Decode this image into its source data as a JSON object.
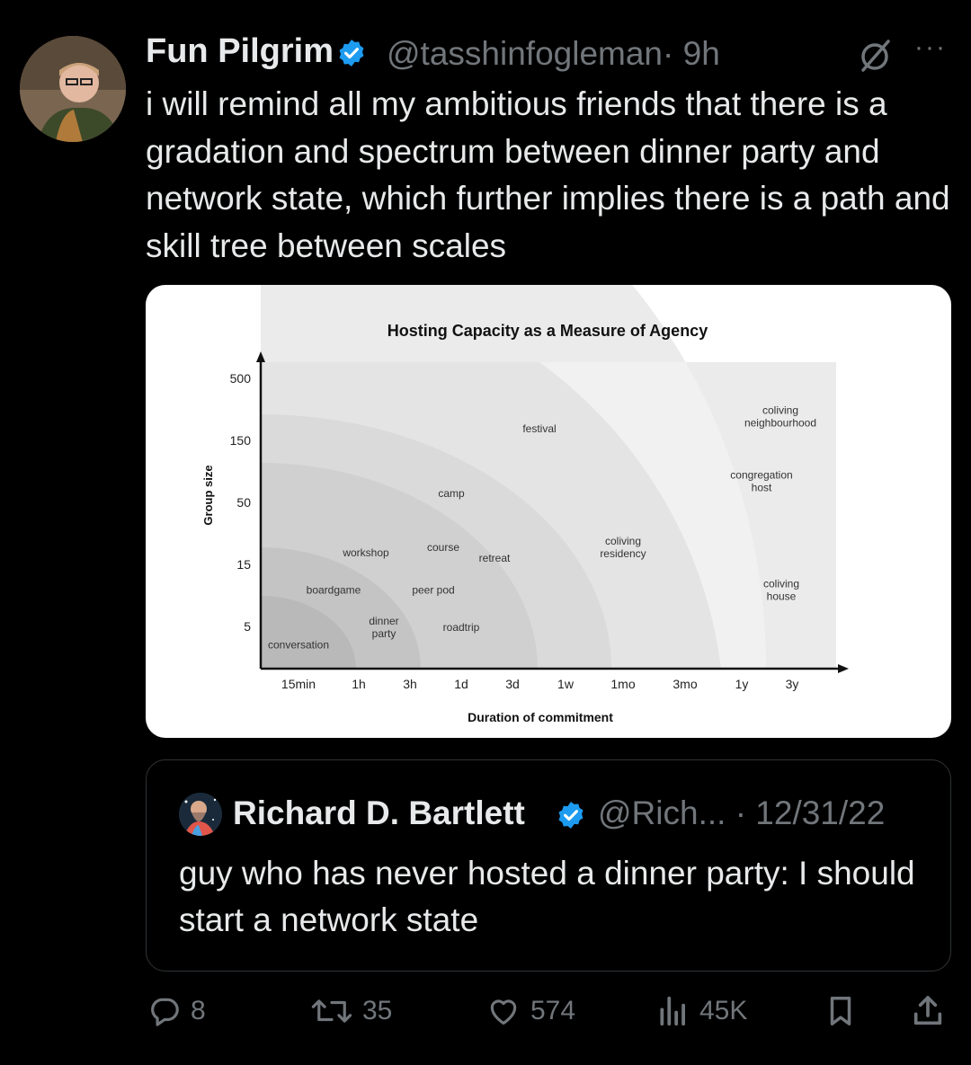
{
  "tweet": {
    "author_name": "Fun Pilgrim",
    "handle": "@tasshinfogleman",
    "time": "· 9h",
    "more": "···",
    "text": "i will remind all my ambitious friends that there is a gradation and spectrum between dinner party and network state, which further implies there is a path and skill tree between scales"
  },
  "chart_data": {
    "type": "scatter",
    "title": "Hosting Capacity as a Measure of Agency",
    "xlabel": "Duration of commitment",
    "ylabel": "Group size",
    "x_ticks": [
      "15min",
      "1h",
      "3h",
      "1d",
      "3d",
      "1w",
      "1mo",
      "3mo",
      "1y",
      "3y"
    ],
    "y_ticks": [
      "5",
      "15",
      "50",
      "150",
      "500"
    ],
    "points": [
      {
        "label": "conversation",
        "x": "15min",
        "y": 4
      },
      {
        "label": "dinner party",
        "x": "3h",
        "y": 5
      },
      {
        "label": "boardgame",
        "x": "1h",
        "y": 10
      },
      {
        "label": "peer pod",
        "x": "3h",
        "y": 10
      },
      {
        "label": "roadtrip",
        "x": "1d",
        "y": 5
      },
      {
        "label": "workshop",
        "x": "1h",
        "y": 20
      },
      {
        "label": "course",
        "x": "3h",
        "y": 20
      },
      {
        "label": "retreat",
        "x": "3d",
        "y": 18
      },
      {
        "label": "camp",
        "x": "1d",
        "y": 60
      },
      {
        "label": "festival",
        "x": "3d",
        "y": 200
      },
      {
        "label": "coliving residency",
        "x": "1mo",
        "y": 22
      },
      {
        "label": "coliving house",
        "x": "1y",
        "y": 10
      },
      {
        "label": "congregation host",
        "x": "1y",
        "y": 75
      },
      {
        "label": "coliving neighbourhood",
        "x": "1y",
        "y": 250
      }
    ],
    "grid": false
  },
  "quote": {
    "author_name": "Richard D. Bartlett",
    "handle": "@Rich... · 12/31/22",
    "text": "guy who has never hosted a dinner party: I should start a network state"
  },
  "actions": {
    "replies": "8",
    "reposts": "35",
    "likes": "574",
    "views": "45K"
  },
  "colors": {
    "background": "#000000",
    "text": "#e7e9ea",
    "muted": "#71767b",
    "verified": "#1d9bf0",
    "card": "#ffffff"
  },
  "icons": [
    "verified-icon",
    "grok-icon",
    "more-icon",
    "reply-icon",
    "repost-icon",
    "like-icon",
    "views-icon",
    "bookmark-icon",
    "share-icon"
  ]
}
